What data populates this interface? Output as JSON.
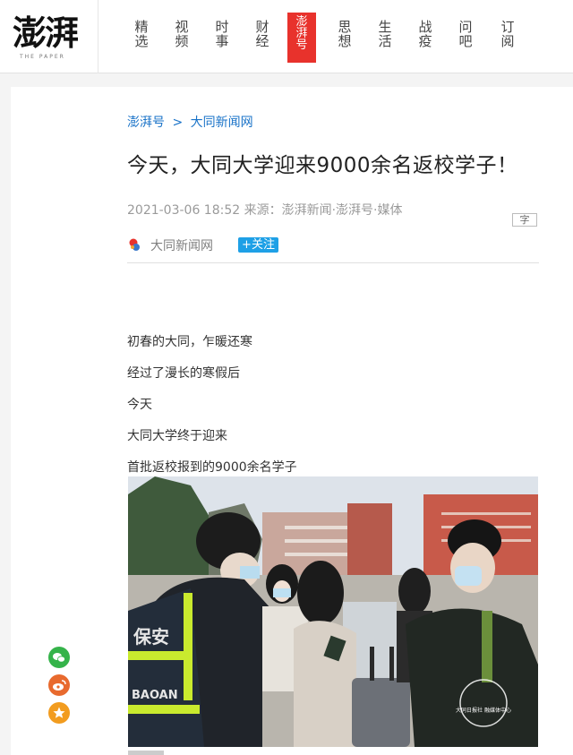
{
  "logo": {
    "main": "澎湃",
    "sub": "THE PAPER"
  },
  "nav": {
    "items": [
      {
        "label": "精选"
      },
      {
        "label": "视频"
      },
      {
        "label": "时事"
      },
      {
        "label": "财经"
      },
      {
        "label": "澎湃号"
      },
      {
        "label": "思想"
      },
      {
        "label": "生活"
      },
      {
        "label": "战疫"
      },
      {
        "label": "问吧"
      },
      {
        "label": "订阅"
      }
    ],
    "active_index": 4
  },
  "article": {
    "breadcrumb": {
      "root": "澎湃号",
      "separator": ">",
      "channel": "大同新闻网"
    },
    "title": "今天，大同大学迎来9000余名返校学子！",
    "meta": "2021-03-06 18:52 来源：澎湃新闻·澎湃号·媒体",
    "font_button": "字",
    "author": {
      "name": "大同新闻网",
      "follow_label": "+关注"
    },
    "paragraphs": [
      "初春的大同，乍暖还寒",
      "经过了漫长的寒假后",
      "今天",
      "大同大学终于迎来",
      "首批返校报到的9000余名学子"
    ],
    "photo": {
      "vest_text": "保安",
      "vest_text_en": "BAOAN",
      "watermark": "大同日报社 融媒体中心"
    }
  },
  "share": {
    "icons": [
      "wechat-icon",
      "weibo-icon",
      "favorite-icon"
    ]
  },
  "colors": {
    "accent_red": "#e8322c",
    "link_blue": "#1a73c8",
    "follow_blue": "#1ea0e6"
  }
}
